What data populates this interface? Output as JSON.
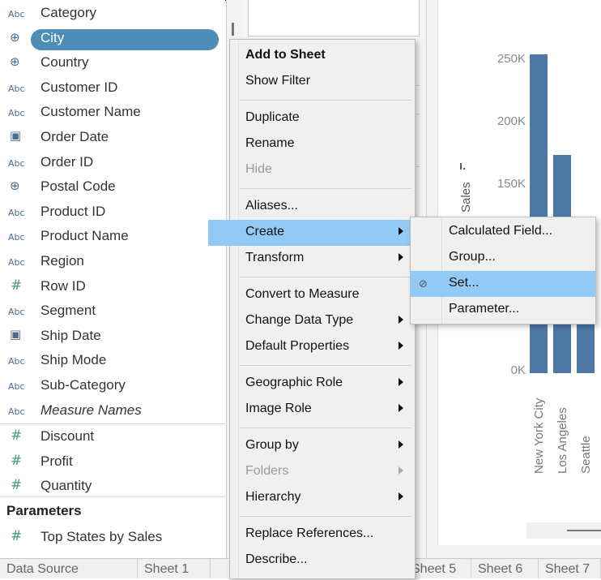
{
  "data_pane": {
    "dimensions": [
      {
        "icon": "Abc",
        "type": "string",
        "label": "Category"
      },
      {
        "icon": "⊕",
        "type": "geo",
        "label": "City",
        "selected": true
      },
      {
        "icon": "⊕",
        "type": "geo",
        "label": "Country"
      },
      {
        "icon": "Abc",
        "type": "string",
        "label": "Customer ID"
      },
      {
        "icon": "Abc",
        "type": "string",
        "label": "Customer Name"
      },
      {
        "icon": "📅",
        "type": "date",
        "label": "Order Date"
      },
      {
        "icon": "Abc",
        "type": "string",
        "label": "Order ID"
      },
      {
        "icon": "⊕",
        "type": "geo",
        "label": "Postal Code"
      },
      {
        "icon": "Abc",
        "type": "string",
        "label": "Product ID"
      },
      {
        "icon": "Abc",
        "type": "string",
        "label": "Product Name"
      },
      {
        "icon": "Abc",
        "type": "string",
        "label": "Region"
      },
      {
        "icon": "#",
        "type": "number",
        "label": "Row ID"
      },
      {
        "icon": "Abc",
        "type": "string",
        "label": "Segment"
      },
      {
        "icon": "📅",
        "type": "date",
        "label": "Ship Date"
      },
      {
        "icon": "Abc",
        "type": "string",
        "label": "Ship Mode"
      },
      {
        "icon": "Abc",
        "type": "string",
        "label": "Sub-Category"
      },
      {
        "icon": "Abc",
        "type": "string",
        "label": "Measure Names",
        "italic": true
      }
    ],
    "measures": [
      {
        "icon": "#",
        "label": "Discount"
      },
      {
        "icon": "#",
        "label": "Profit"
      },
      {
        "icon": "#",
        "label": "Quantity"
      }
    ],
    "parameters_heading": "Parameters",
    "parameters": [
      {
        "icon": "#",
        "label": "Top States by Sales"
      }
    ]
  },
  "context_menu": {
    "items": [
      {
        "label": "Add to Sheet",
        "bold": true
      },
      {
        "label": "Show Filter"
      },
      {
        "sep": true
      },
      {
        "label": "Duplicate"
      },
      {
        "label": "Rename"
      },
      {
        "label": "Hide",
        "disabled": true
      },
      {
        "sep": true
      },
      {
        "label": "Aliases..."
      },
      {
        "label": "Create",
        "submenu": true,
        "active": true
      },
      {
        "label": "Transform",
        "submenu": true
      },
      {
        "sep": true
      },
      {
        "label": "Convert to Measure"
      },
      {
        "label": "Change Data Type",
        "submenu": true
      },
      {
        "label": "Default Properties",
        "submenu": true
      },
      {
        "sep": true
      },
      {
        "label": "Geographic Role",
        "submenu": true
      },
      {
        "label": "Image Role",
        "submenu": true
      },
      {
        "sep": true
      },
      {
        "label": "Group by",
        "submenu": true
      },
      {
        "label": "Folders",
        "submenu": true,
        "disabled": true
      },
      {
        "label": "Hierarchy",
        "submenu": true
      },
      {
        "sep": true
      },
      {
        "label": "Replace References..."
      },
      {
        "label": "Describe..."
      }
    ]
  },
  "create_submenu": {
    "items": [
      {
        "label": "Calculated Field..."
      },
      {
        "label": "Group..."
      },
      {
        "label": "Set...",
        "active": true,
        "icon": "set-icon"
      },
      {
        "label": "Parameter..."
      }
    ]
  },
  "chart": {
    "y_axis_title": "Sales",
    "colors": {
      "bar": "#4e79a7"
    }
  },
  "chart_data": {
    "type": "bar",
    "ylabel": "Sales",
    "xlabel": "",
    "y_ticks": [
      "250K",
      "200K",
      "150K",
      "0K"
    ],
    "ylim": [
      0,
      280000
    ],
    "categories": [
      "New York City",
      "Los Angeles",
      "Seattle"
    ],
    "values": [
      256000,
      175000,
      120000
    ]
  },
  "tabs": [
    "Data Source",
    "Sheet 1",
    "Sheet 5",
    "Sheet 6",
    "Sheet 7"
  ],
  "colors": {
    "selection": "#4e8db5",
    "menu_highlight": "#91c9f7"
  }
}
